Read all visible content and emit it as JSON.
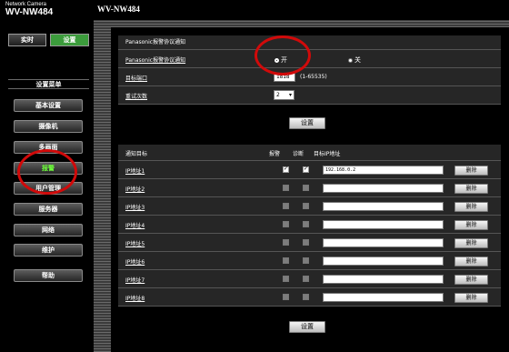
{
  "brand": {
    "small": "Network Camera",
    "model": "WV-NW484"
  },
  "header": {
    "model": "WV-NW484"
  },
  "mode_tabs": {
    "live": "实时",
    "setup": "设置"
  },
  "menu": {
    "title": "设置菜单",
    "items": [
      {
        "label": "基本设置"
      },
      {
        "label": "摄像机"
      },
      {
        "label": "多画面"
      },
      {
        "label": "报警",
        "active": true
      },
      {
        "label": "用户管理"
      },
      {
        "label": "服务器"
      },
      {
        "label": "网络"
      },
      {
        "label": "维护"
      },
      {
        "label": "帮助"
      }
    ]
  },
  "alarm_notify": {
    "header": "Panasonic报警协议通知",
    "rows": {
      "protocol": "Panasonic报警协议通知",
      "dest_port": "目标端口",
      "retry": "重试次数"
    },
    "radio_on": "开",
    "radio_off": "关",
    "port_value": "1818",
    "port_hint": "(1-65535)",
    "retry_value": "2",
    "set_button": "设置"
  },
  "targets": {
    "header": "通知目标",
    "col_alarm": "报警",
    "col_diag": "诊断",
    "col_ip": "目标IP地址",
    "rows": [
      {
        "label": "IP地址1",
        "alarm": true,
        "diag": true,
        "ip": "192.168.0.2",
        "delete": "删除"
      },
      {
        "label": "IP地址2",
        "alarm": false,
        "diag": false,
        "ip": "",
        "delete": "删除"
      },
      {
        "label": "IP地址3",
        "alarm": false,
        "diag": false,
        "ip": "",
        "delete": "删除"
      },
      {
        "label": "IP地址4",
        "alarm": false,
        "diag": false,
        "ip": "",
        "delete": "删除"
      },
      {
        "label": "IP地址5",
        "alarm": false,
        "diag": false,
        "ip": "",
        "delete": "删除"
      },
      {
        "label": "IP地址6",
        "alarm": false,
        "diag": false,
        "ip": "",
        "delete": "删除"
      },
      {
        "label": "IP地址7",
        "alarm": false,
        "diag": false,
        "ip": "",
        "delete": "删除"
      },
      {
        "label": "IP地址8",
        "alarm": false,
        "diag": false,
        "ip": "",
        "delete": "删除"
      }
    ],
    "set_button": "设置"
  },
  "colors": {
    "accent_green": "#3c9c3c",
    "active_text": "#6dff3a",
    "annotation_red": "#d10a0a"
  }
}
